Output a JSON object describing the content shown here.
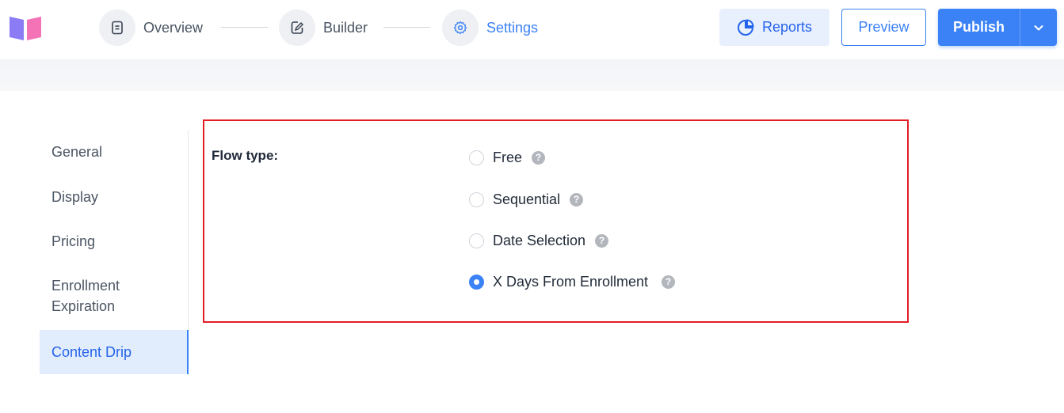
{
  "steps": [
    {
      "label": "Overview",
      "icon": "document-icon"
    },
    {
      "label": "Builder",
      "icon": "edit-icon"
    },
    {
      "label": "Settings",
      "icon": "gear-icon",
      "active": true
    }
  ],
  "header": {
    "reports_label": "Reports",
    "preview_label": "Preview",
    "publish_label": "Publish"
  },
  "sidenav": {
    "items": [
      {
        "label": "General"
      },
      {
        "label": "Display"
      },
      {
        "label": "Pricing"
      },
      {
        "label": "Enrollment Expiration"
      },
      {
        "label": "Content Drip",
        "active": true
      }
    ]
  },
  "content_drip": {
    "field_label": "Flow type:",
    "options": [
      {
        "label": "Free",
        "selected": false
      },
      {
        "label": "Sequential",
        "selected": false
      },
      {
        "label": "Date Selection",
        "selected": false
      },
      {
        "label": "X Days From Enrollment",
        "selected": true
      }
    ],
    "help_glyph": "?"
  },
  "colors": {
    "accent": "#3b82f6",
    "highlight_border": "#e11d27",
    "logo_purple": "#8b7cf6",
    "logo_pink": "#f472b6"
  }
}
